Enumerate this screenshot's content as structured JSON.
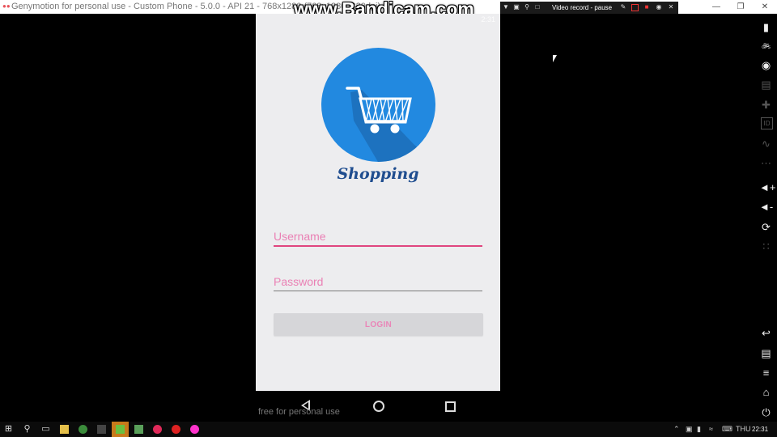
{
  "window": {
    "title": "Genymotion for personal use - Custom Phone - 5.0.0 - API 21 - 768x1280 (768x1280, 320dpi)",
    "watermark": "www.Bandicam.com",
    "minimize_glyph": "—",
    "restore_glyph": "❐",
    "close_glyph": "✕"
  },
  "recorder": {
    "label": "Video record - pause"
  },
  "phone": {
    "status_time": "2:31",
    "logo_text": "Shopping",
    "username_placeholder": "Username",
    "password_placeholder": "Password",
    "login_label": "LOGIN",
    "accent_color": "#e0457f",
    "logo_color": "#2289e0"
  },
  "emulator": {
    "free_note": "free for personal use"
  },
  "sidebar": {
    "gps_label": "GPS",
    "id_label": "ID",
    "icons": [
      "battery-icon",
      "gps-icon",
      "camera-icon",
      "clapper-icon",
      "dpad-icon",
      "id-icon",
      "network-icon",
      "sms-icon",
      "volume-up-icon",
      "volume-down-icon",
      "rotate-icon",
      "scale-icon",
      "back-icon",
      "recent-apps-icon",
      "menu-icon",
      "home-icon",
      "power-icon"
    ]
  },
  "taskbar": {
    "clock": "22:31",
    "lang": "THU"
  }
}
